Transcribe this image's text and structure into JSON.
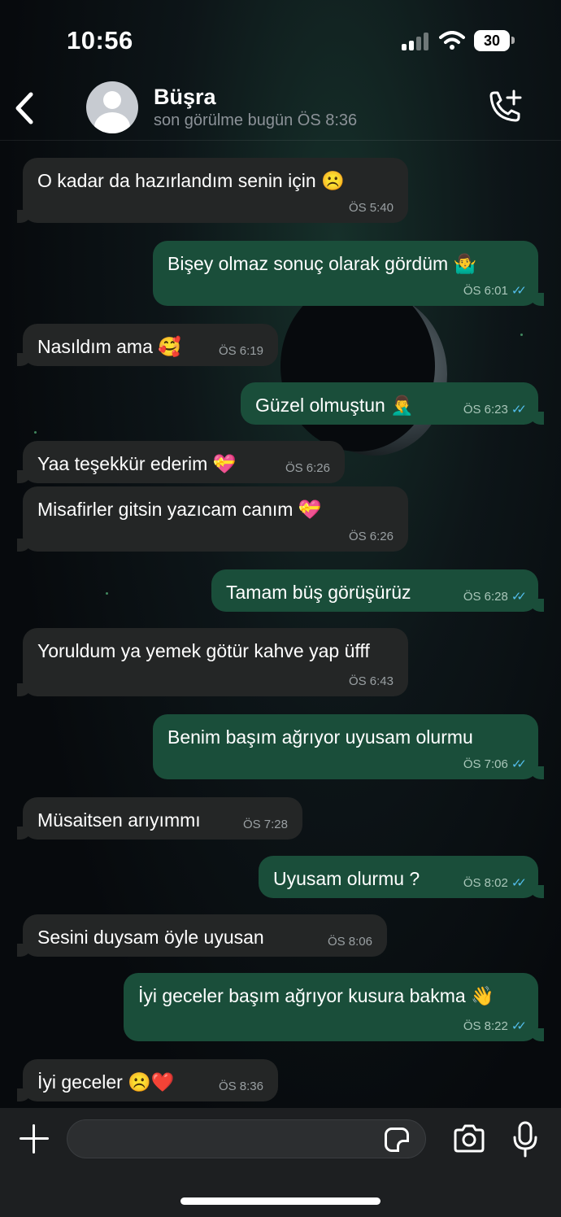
{
  "status_bar": {
    "time": "10:56",
    "battery": "30"
  },
  "header": {
    "name": "Büşra",
    "last_seen": "son görülme bugün ÖS 8:36"
  },
  "messages": [
    {
      "dir": "in",
      "text": "O kadar da hazırlandım senin için ☹️",
      "time": "ÖS 5:40"
    },
    {
      "dir": "out",
      "text": "Bişey olmaz sonuç olarak gördüm 🤷‍♂️",
      "time": "ÖS 6:01"
    },
    {
      "dir": "in",
      "text": "Nasıldım ama 🥰",
      "time": "ÖS 6:19"
    },
    {
      "dir": "out",
      "text": "Güzel olmuştun 🤦‍♂️",
      "time": "ÖS 6:23"
    },
    {
      "dir": "in",
      "text": "Yaa teşekkür ederim 💝",
      "time": "ÖS 6:26"
    },
    {
      "dir": "in",
      "text": "Misafirler gitsin yazıcam canım 💝",
      "time": "ÖS 6:26"
    },
    {
      "dir": "out",
      "text": "Tamam büş görüşürüz",
      "time": "ÖS 6:28"
    },
    {
      "dir": "in",
      "text": "Yoruldum ya yemek götür kahve yap üfff",
      "time": "ÖS 6:43"
    },
    {
      "dir": "out",
      "text": "Benim başım ağrıyor uyusam olurmu",
      "time": "ÖS 7:06"
    },
    {
      "dir": "in",
      "text": "Müsaitsen arıyımmı",
      "time": "ÖS 7:28"
    },
    {
      "dir": "out",
      "text": "Uyusam olurmu ?",
      "time": "ÖS 8:02"
    },
    {
      "dir": "in",
      "text": "Sesini duysam öyle uyusan",
      "time": "ÖS 8:06"
    },
    {
      "dir": "out",
      "text": "İyi geceler başım ağrıyor kusura bakma 👋",
      "time": "ÖS 8:22"
    },
    {
      "dir": "in",
      "text": "İyi geceler ☹️❤️",
      "time": "ÖS 8:36"
    }
  ],
  "read_ticks": "✓✓",
  "icons": {
    "back": "chevron-left-icon",
    "call": "add-call-icon",
    "attach": "plus-icon",
    "sticker": "sticker-icon",
    "camera": "camera-icon",
    "mic": "microphone-icon"
  },
  "colors": {
    "incoming_bubble": "#242626",
    "outgoing_bubble": "#1a4e3a",
    "read_tick": "#53bdeb"
  }
}
